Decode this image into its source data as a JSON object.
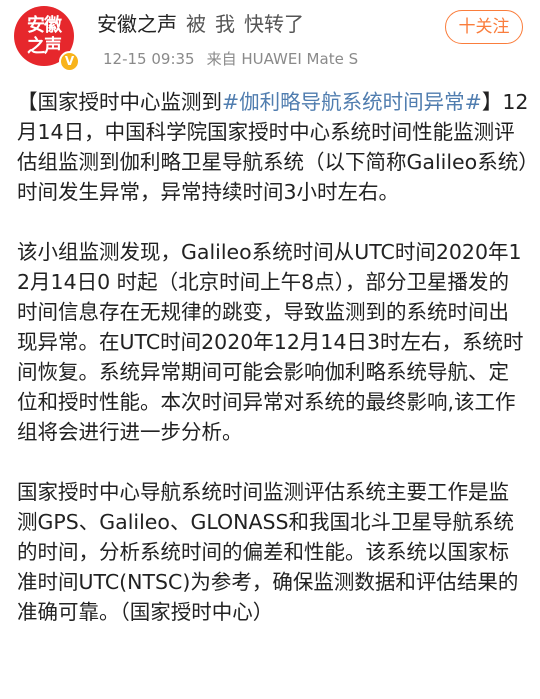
{
  "header": {
    "user_name": "安徽之声",
    "forward_word_1": "被",
    "forward_word_2": "我",
    "forward_word_3": "快转了",
    "time": "12-15 09:35",
    "source": "来自 HUAWEI Mate S",
    "follow_label": "十关注",
    "avatar_text_line1": "安徽",
    "avatar_text_line2": "之声",
    "verified_badge": "V",
    "icons": {
      "verified": "verified-badge-icon"
    },
    "colors": {
      "avatar_red": "#e6272c",
      "follow_orange": "#fa7d3c",
      "topic_blue": "#507daf",
      "verified_yellow": "#f8b31a"
    }
  },
  "post": {
    "p1_open_bracket": "【国家授时中心监测到",
    "p1_topic": "#伽利略导航系统时间异常#",
    "p1_rest": "】12月14日，中国科学院国家授时中心系统时间性能监测评估组监测到伽利略卫星导航系统（以下简称Galileo系统）时间发生异常，异常持续时间3小时左右。",
    "p2": "该小组监测发现，Galileo系统时间从UTC时间2020年12月14日0 时起（北京时间上午8点），部分卫星播发的时间信息存在无规律的跳变，导致监测到的系统时间出现异常。在UTC时间2020年12月14日3时左右，系统时间恢复。系统异常期间可能会影响伽利略系统导航、定位和授时性能。本次时间异常对系统的最终影响,该工作组将会进行进一步分析。",
    "p3": "国家授时中心导航系统时间监测评估系统主要工作是监测GPS、Galileo、GLONASS和我国北斗卫星导航系统的时间，分析系统时间的偏差和性能。该系统以国家标准时间UTC(NTSC)为参考，确保监测数据和评估结果的准确可靠。（国家授时中心）"
  }
}
